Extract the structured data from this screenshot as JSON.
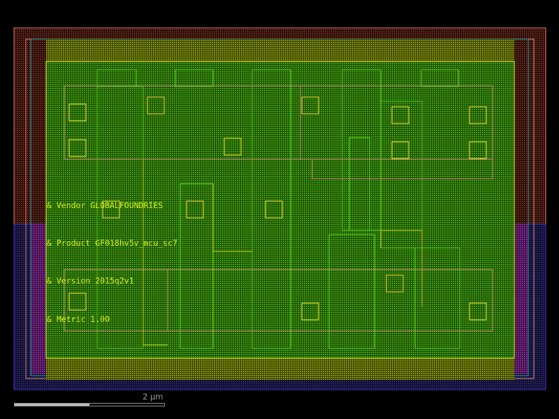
{
  "annotations": [
    "& Vendor GLOBALFOUNDRIES",
    "& Product GF018hv5v_mcu_sc7",
    "& Version 2015q2v1",
    "& Metric 1.00"
  ],
  "scale": {
    "label": "2 µm",
    "filled_fraction": 0.5
  },
  "colors": {
    "background": "#000000",
    "nwell": "#e07a5f",
    "pwell": "#3b3bc9",
    "pwell_fill": "#a02fb0",
    "diffusion": "#3cb000",
    "poly": "#d3e21e",
    "contact": "#d9cc2c",
    "metal": "#c98a7a",
    "text": "#d7ef1c"
  }
}
